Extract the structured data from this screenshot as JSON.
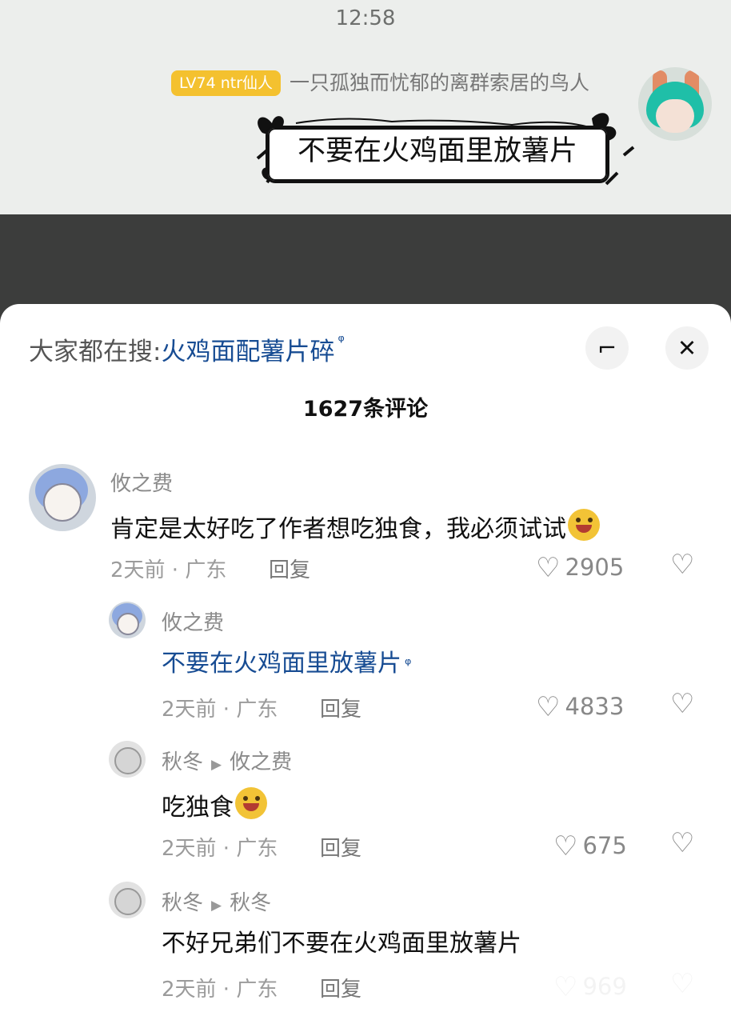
{
  "status": {
    "time": "12:58"
  },
  "header": {
    "level_badge": "LV74 ntr仙人",
    "sender_name": "一只孤独而忧郁的离群索居的鸟人",
    "message": "不要在火鸡面里放薯片"
  },
  "sheet": {
    "search_label": "大家都在搜:",
    "search_term": "火鸡面配薯片碎",
    "expand_icon": "expand-icon",
    "close_icon": "close-icon",
    "comment_count": "1627条评论"
  },
  "comments": [
    {
      "name": "攸之费",
      "text": "肯定是太好吃了作者想吃独食，我必须试试",
      "emoji": "smiling-face",
      "meta": "2天前 · 广东",
      "reply": "回复",
      "likes": "2905"
    },
    {
      "name": "攸之费",
      "text": "不要在火鸡面里放薯片",
      "meta": "2天前 · 广东",
      "reply": "回复",
      "likes": "4833"
    },
    {
      "name": "秋冬",
      "to": "攸之费",
      "text": "吃独食",
      "emoji": "grinning-face",
      "meta": "2天前 · 广东",
      "reply": "回复",
      "likes": "675"
    },
    {
      "name": "秋冬",
      "to": "秋冬",
      "text": "不好兄弟们不要在火鸡面里放薯片",
      "meta": "2天前 · 广东",
      "reply": "回复",
      "likes": "969"
    }
  ],
  "colors": {
    "accent": "#174c93",
    "badge": "#f4c12f",
    "background": "#ffffff"
  }
}
